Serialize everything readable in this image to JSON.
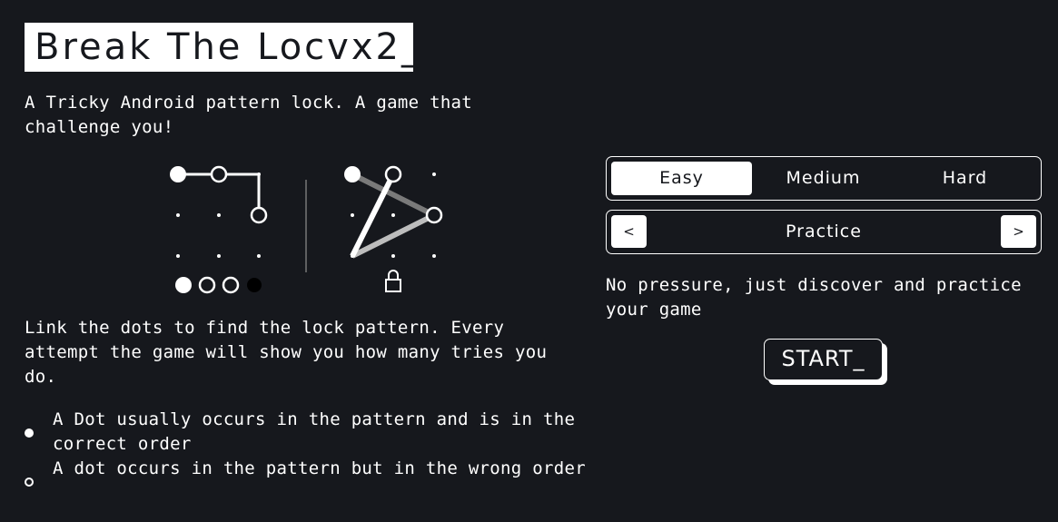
{
  "header": {
    "title": "Break The Locvx2_"
  },
  "intro": {
    "description": "A Tricky Android pattern lock. A game that challenge you!"
  },
  "instructions": {
    "text": "Link the dots to find the lock pattern. Every attempt the game will show you how many tries you do.",
    "legend": [
      {
        "icon": "filled-dot",
        "text": "A Dot usually occurs in the pattern and is in the correct order"
      },
      {
        "icon": "hollow-dot",
        "text": "A dot occurs in the pattern but in the wrong order"
      }
    ]
  },
  "difficulty": {
    "options": [
      "Easy",
      "Medium",
      "Hard"
    ],
    "selected": "Easy"
  },
  "mode": {
    "prev_label": "<",
    "next_label": ">",
    "current": "Practice",
    "description": "No pressure, just discover and practice your game"
  },
  "start_button": {
    "label": "START_"
  },
  "colors": {
    "background": "#16181d",
    "foreground": "#ffffff",
    "grey_line": "#7a7a7a"
  }
}
